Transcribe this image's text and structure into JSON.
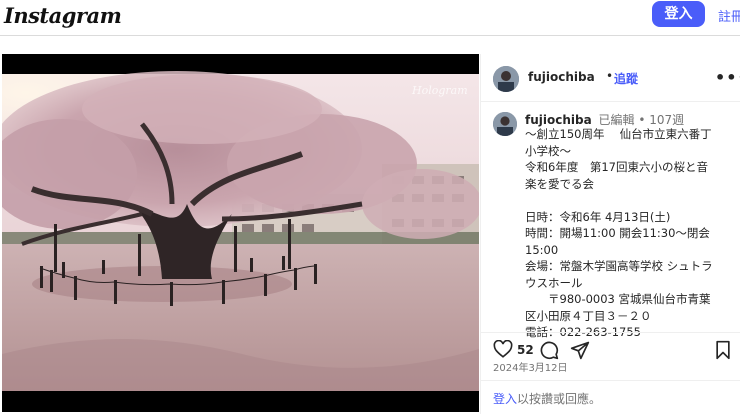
{
  "topbar": {
    "logo": "Instagram",
    "login_button": "登入",
    "signup_link": "註冊"
  },
  "post": {
    "username": "fujiochiba",
    "follow_dot": "•",
    "follow_label": "追蹤",
    "more_icon": "more-horizontal-icon",
    "media_alt": "cherry-blossom-tree-schoolyard-photo",
    "caption": {
      "username": "fujiochiba",
      "edited": "已編輯",
      "time": "• 107週",
      "lines": [
        "〜創立150周年　 仙台市立東六番丁",
        "小学校〜",
        "令和6年度　第17回東六小の桜と音",
        "楽を愛でる会",
        "",
        "日時：令和6年 4月13日(土)",
        "時間：開場11:00 開会11:30〜閉会",
        "15:00",
        "会場：常盤木学園高等学校 シュトラ",
        "ウスホール",
        "　　〒980-0003 宮城県仙台市青葉",
        "区小田原４丁目３－２０",
        "電話：022-263-1755"
      ]
    },
    "likes": "52",
    "date": "2024年3月12日",
    "login_prompt_link": "登入",
    "login_prompt_text": "以按讚或回應。"
  }
}
